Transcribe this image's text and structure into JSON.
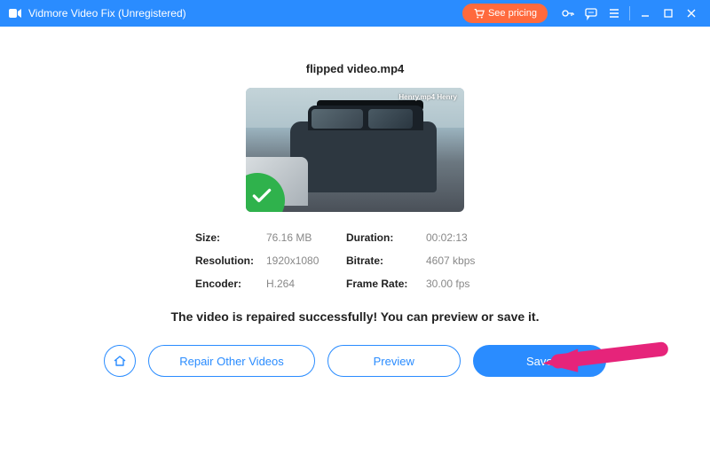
{
  "titlebar": {
    "title": "Vidmore Video Fix (Unregistered)",
    "pricing_label": "See pricing"
  },
  "file": {
    "name": "flipped video.mp4",
    "thumb_label": "Henry.mp4 Henry"
  },
  "info": {
    "size_label": "Size:",
    "size_value": "76.16 MB",
    "duration_label": "Duration:",
    "duration_value": "00:02:13",
    "resolution_label": "Resolution:",
    "resolution_value": "1920x1080",
    "bitrate_label": "Bitrate:",
    "bitrate_value": "4607 kbps",
    "encoder_label": "Encoder:",
    "encoder_value": "H.264",
    "framerate_label": "Frame Rate:",
    "framerate_value": "30.00 fps"
  },
  "status_message": "The video is repaired successfully! You can preview or save it.",
  "buttons": {
    "repair_other": "Repair Other Videos",
    "preview": "Preview",
    "save": "Save"
  },
  "colors": {
    "accent": "#2a8cff",
    "success": "#2fb24c",
    "cta": "#ff6a3d",
    "arrow": "#e6247a"
  }
}
